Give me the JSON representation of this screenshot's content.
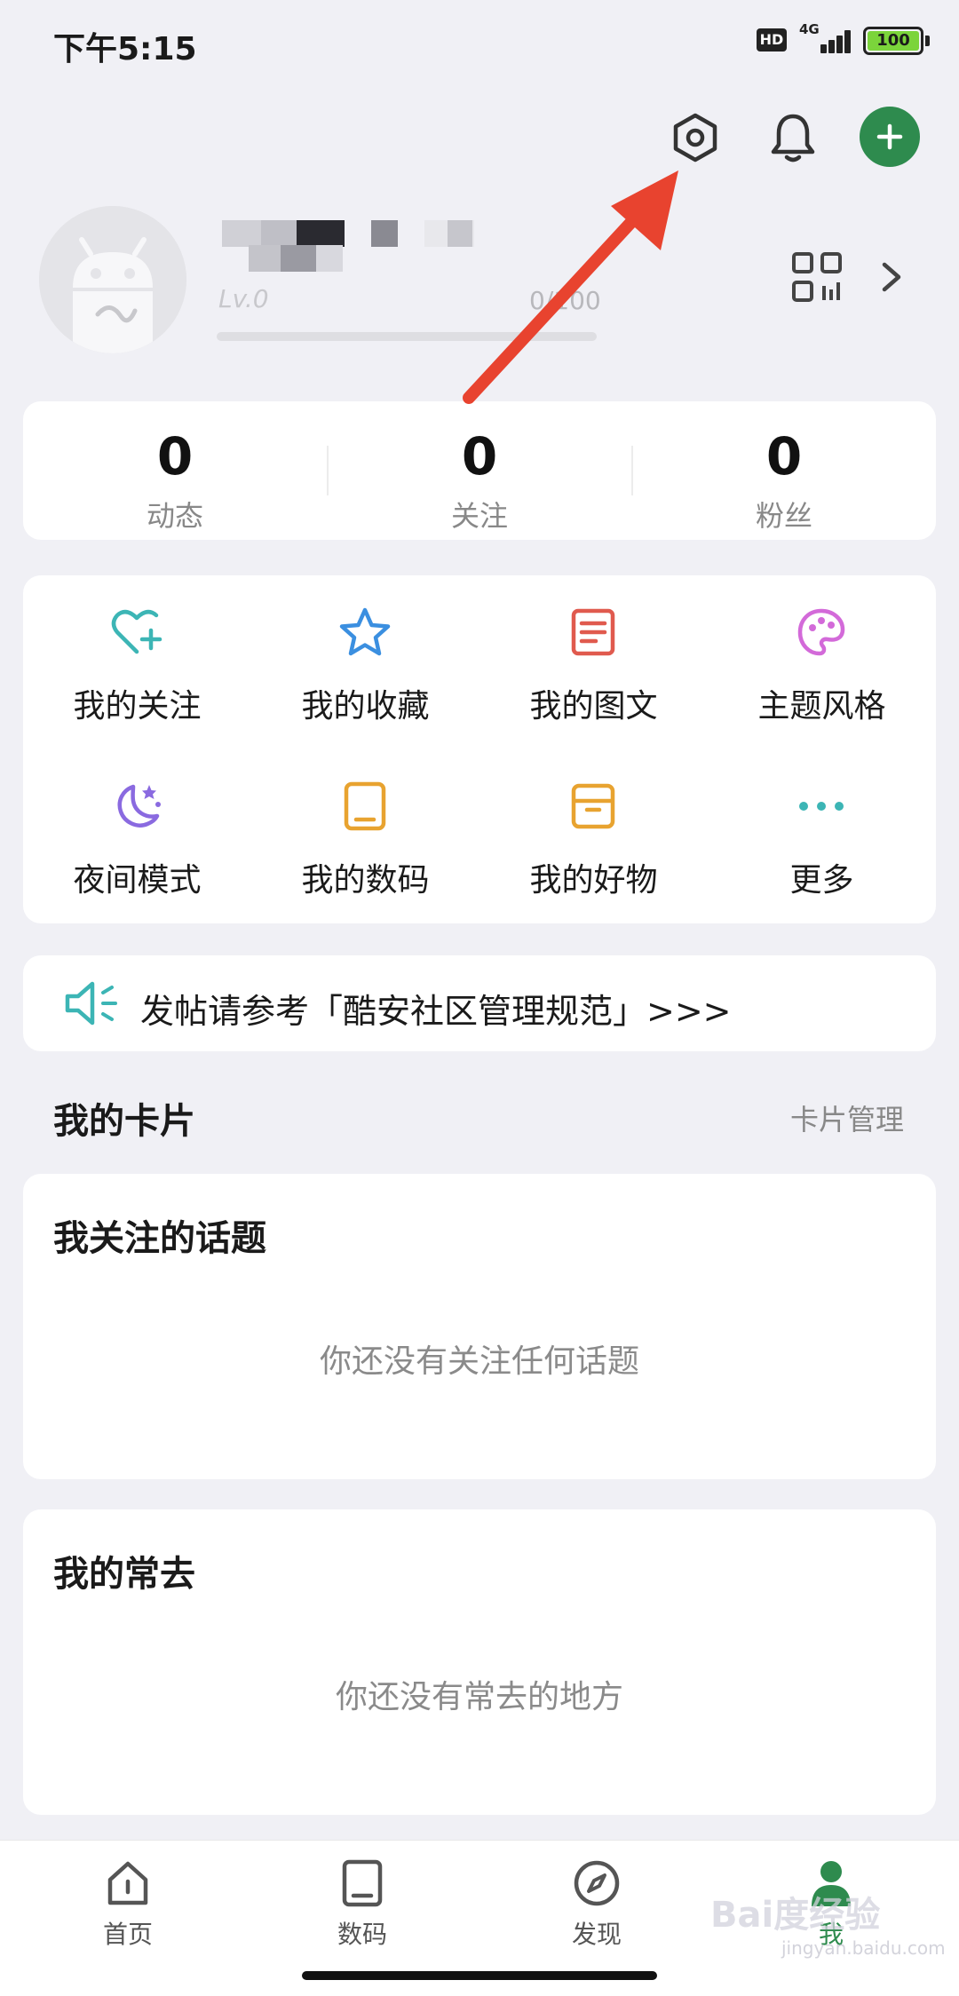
{
  "status_bar": {
    "time": "下午5:15",
    "hd": "HD",
    "network": "4G",
    "battery": "100"
  },
  "header": {
    "settings_icon": "settings-hexagon-icon",
    "bell_icon": "bell-icon",
    "add_icon": "plus-icon",
    "accent_color": "#2e8b4e"
  },
  "profile": {
    "level": "Lv.0",
    "xp": "0/100"
  },
  "stats": [
    {
      "value": "0",
      "label": "动态"
    },
    {
      "value": "0",
      "label": "关注"
    },
    {
      "value": "0",
      "label": "粉丝"
    }
  ],
  "menu": [
    {
      "label": "我的关注",
      "icon": "heart-plus-icon",
      "color": "#3cb5b5"
    },
    {
      "label": "我的收藏",
      "icon": "star-icon",
      "color": "#3b8fe0"
    },
    {
      "label": "我的图文",
      "icon": "document-icon",
      "color": "#e05a4e"
    },
    {
      "label": "主题风格",
      "icon": "palette-icon",
      "color": "#d36ad9"
    },
    {
      "label": "夜间模式",
      "icon": "moon-icon",
      "color": "#8a6ae0"
    },
    {
      "label": "我的数码",
      "icon": "tablet-icon",
      "color": "#e8a330"
    },
    {
      "label": "我的好物",
      "icon": "box-icon",
      "color": "#e8a330"
    },
    {
      "label": "更多",
      "icon": "more-dots-icon",
      "color": "#3cb5b5"
    }
  ],
  "notice": {
    "text": "发帖请参考「酷安社区管理规范」>>>",
    "icon": "speaker-icon"
  },
  "cards_section": {
    "title": "我的卡片",
    "manage_link": "卡片管理"
  },
  "topics_card": {
    "title": "我关注的话题",
    "empty": "你还没有关注任何话题"
  },
  "frequent_card": {
    "title": "我的常去",
    "empty": "你还没有常去的地方"
  },
  "bottom_nav": [
    {
      "label": "首页",
      "icon": "home-icon"
    },
    {
      "label": "数码",
      "icon": "tablet-icon"
    },
    {
      "label": "发现",
      "icon": "compass-icon"
    },
    {
      "label": "我",
      "icon": "person-icon",
      "active": true
    }
  ],
  "watermark": {
    "text": "Bai度经验",
    "sub": "jingyan.baidu.com"
  }
}
